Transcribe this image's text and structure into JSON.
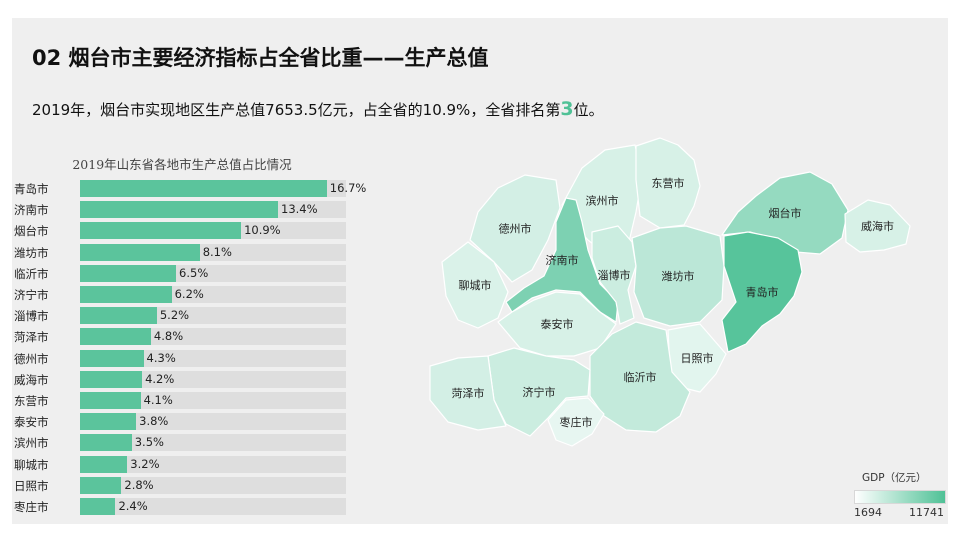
{
  "slide": {
    "title": "02 烟台市主要经济指标占全省比重——生产总值",
    "subtitle_prefix": "2019年，烟台市实现地区生产总值7653.5亿元，占全省的10.9%，全省排名第",
    "subtitle_rank": "3",
    "subtitle_suffix": "位。"
  },
  "colors": {
    "accent": "#4fc196",
    "bar": "#5bc49c",
    "bar_track": "#dedede",
    "map_low": "#ffffff",
    "map_high": "#4fc196"
  },
  "chart_data": [
    {
      "type": "bar",
      "orientation": "horizontal",
      "title": "2019年山东省各地市生产总值占比情况",
      "categories": [
        "青岛市",
        "济南市",
        "烟台市",
        "潍坊市",
        "临沂市",
        "济宁市",
        "淄博市",
        "菏泽市",
        "德州市",
        "威海市",
        "东营市",
        "泰安市",
        "滨州市",
        "聊城市",
        "日照市",
        "枣庄市"
      ],
      "values": [
        16.7,
        13.4,
        10.9,
        8.1,
        6.5,
        6.2,
        5.2,
        4.8,
        4.3,
        4.2,
        4.1,
        3.8,
        3.5,
        3.2,
        2.8,
        2.4
      ],
      "value_labels": [
        "16.7%",
        "13.4%",
        "10.9%",
        "8.1%",
        "6.5%",
        "6.2%",
        "5.2%",
        "4.8%",
        "4.3%",
        "4.2%",
        "4.1%",
        "3.8%",
        "3.5%",
        "3.2%",
        "2.8%",
        "2.4%"
      ],
      "unit": "%"
    },
    {
      "type": "choropleth",
      "legend": {
        "title": "GDP（亿元）",
        "min": 1694,
        "max": 11741,
        "min_label": "1694",
        "max_label": "11741"
      },
      "regions": [
        {
          "name": "德州市",
          "shade": 0.15
        },
        {
          "name": "滨州市",
          "shade": 0.12
        },
        {
          "name": "东营市",
          "shade": 0.12
        },
        {
          "name": "烟台市",
          "shade": 0.55
        },
        {
          "name": "威海市",
          "shade": 0.12
        },
        {
          "name": "聊城市",
          "shade": 0.1
        },
        {
          "name": "济南市",
          "shade": 0.7
        },
        {
          "name": "淄博市",
          "shade": 0.2
        },
        {
          "name": "潍坊市",
          "shade": 0.3
        },
        {
          "name": "青岛市",
          "shade": 0.95
        },
        {
          "name": "泰安市",
          "shade": 0.12
        },
        {
          "name": "日照市",
          "shade": 0.05
        },
        {
          "name": "临沂市",
          "shade": 0.25
        },
        {
          "name": "济宁市",
          "shade": 0.2
        },
        {
          "name": "菏泽市",
          "shade": 0.15
        },
        {
          "name": "枣庄市",
          "shade": 0.02
        }
      ]
    }
  ]
}
